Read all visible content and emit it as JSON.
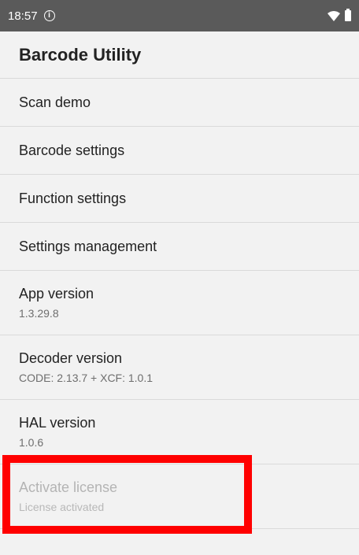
{
  "status_bar": {
    "time": "18:57",
    "info_icon": "info-icon",
    "wifi_icon": "wifi-icon",
    "battery_icon": "battery-icon"
  },
  "app_bar": {
    "title": "Barcode Utility"
  },
  "list": [
    {
      "title": "Scan demo"
    },
    {
      "title": "Barcode settings"
    },
    {
      "title": "Function settings"
    },
    {
      "title": "Settings management"
    },
    {
      "title": "App version",
      "subtitle": "1.3.29.8"
    },
    {
      "title": "Decoder version",
      "subtitle": "CODE: 2.13.7 + XCF: 1.0.1"
    },
    {
      "title": "HAL version",
      "subtitle": "1.0.6"
    },
    {
      "title": "Activate license",
      "subtitle": "License activated",
      "enabled": false
    }
  ],
  "colors": {
    "status_bar_bg": "#5a5a5a",
    "background": "#f2f2f2",
    "highlight_box": "#ff0000"
  }
}
